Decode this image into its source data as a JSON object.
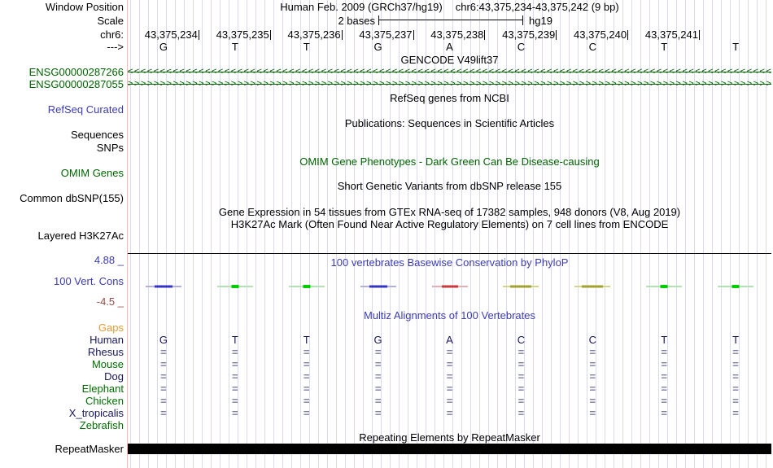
{
  "header": {
    "left_labels": {
      "window_position": "Window Position",
      "scale": "Scale",
      "chrom": "chr6:",
      "strand": "--->"
    },
    "assembly": "Human Feb. 2009 (GRCh37/hg19)",
    "position": "chr6:43,375,234-43,375,242 (9 bp)",
    "scale_text": "2 bases",
    "scale_genome": "hg19"
  },
  "ruler": {
    "positions": [
      "43,375,234",
      "43,375,235",
      "43,375,236",
      "43,375,237",
      "43,375,238",
      "43,375,239",
      "43,375,240",
      "43,375,241"
    ],
    "bases": [
      "G",
      "T",
      "T",
      "G",
      "A",
      "C",
      "C",
      "T",
      "T"
    ]
  },
  "gencode": {
    "title": "GENCODE V49lift37",
    "genes": [
      {
        "id": "ENSG00000287266",
        "strand": "<"
      },
      {
        "id": "ENSG00000287055",
        "strand": ">"
      }
    ]
  },
  "refseq": {
    "title": "RefSeq genes from NCBI",
    "label": "RefSeq Curated"
  },
  "publications": {
    "title": "Publications: Sequences in Scientific Articles",
    "sequences_label": "Sequences",
    "snps_label": "SNPs"
  },
  "omim": {
    "title": "OMIM Gene Phenotypes - Dark Green Can Be Disease-causing",
    "label": "OMIM Genes"
  },
  "dbsnp": {
    "title": "Short Genetic Variants from dbSNP release 155",
    "label": "Common dbSNP(155)"
  },
  "gtex": {
    "title": "Gene Expression in 54 tissues from GTEx RNA-seq of 17382 samples, 948 donors (V8, Aug 2019)"
  },
  "h3k27ac": {
    "title": "H3K27Ac Mark (Often Found Near Active Regulatory Elements) on 7 cell lines from ENCODE",
    "label": "Layered H3K27Ac"
  },
  "phylop": {
    "title": "100 vertebrates Basewise Conservation by PhyloP",
    "label": "100 Vert. Cons",
    "max": "4.88 _",
    "min": "-4.5 _",
    "segments": [
      "blue",
      "green",
      "green",
      "blue",
      "red",
      "olive",
      "olive",
      "green",
      "green"
    ]
  },
  "multiz": {
    "title": "Multiz Alignments of 100 Vertebrates",
    "gaps_label": "Gaps",
    "alignment_mark": "=",
    "species": [
      {
        "name": "Human"
      },
      {
        "name": "Rhesus"
      },
      {
        "name": "Mouse"
      },
      {
        "name": "Dog"
      },
      {
        "name": "Elephant"
      },
      {
        "name": "Chicken"
      },
      {
        "name": "X_tropicalis"
      },
      {
        "name": "Zebrafish"
      }
    ]
  },
  "repeatmasker": {
    "title": "Repeating Elements by RepeatMasker",
    "label": "RepeatMasker"
  },
  "colors": {
    "gene_green": "#006400",
    "track_blue": "#3c3cb4",
    "min_maroon": "#994c44",
    "gaps_orange": "#e69a33",
    "species_navy": "#16165e",
    "species_green": "#006e00",
    "align_mark": "#7d7da5",
    "gridline": "#d9d9f2",
    "edge_pink": "#ffb6b6",
    "repeat_bar": "#000000"
  }
}
